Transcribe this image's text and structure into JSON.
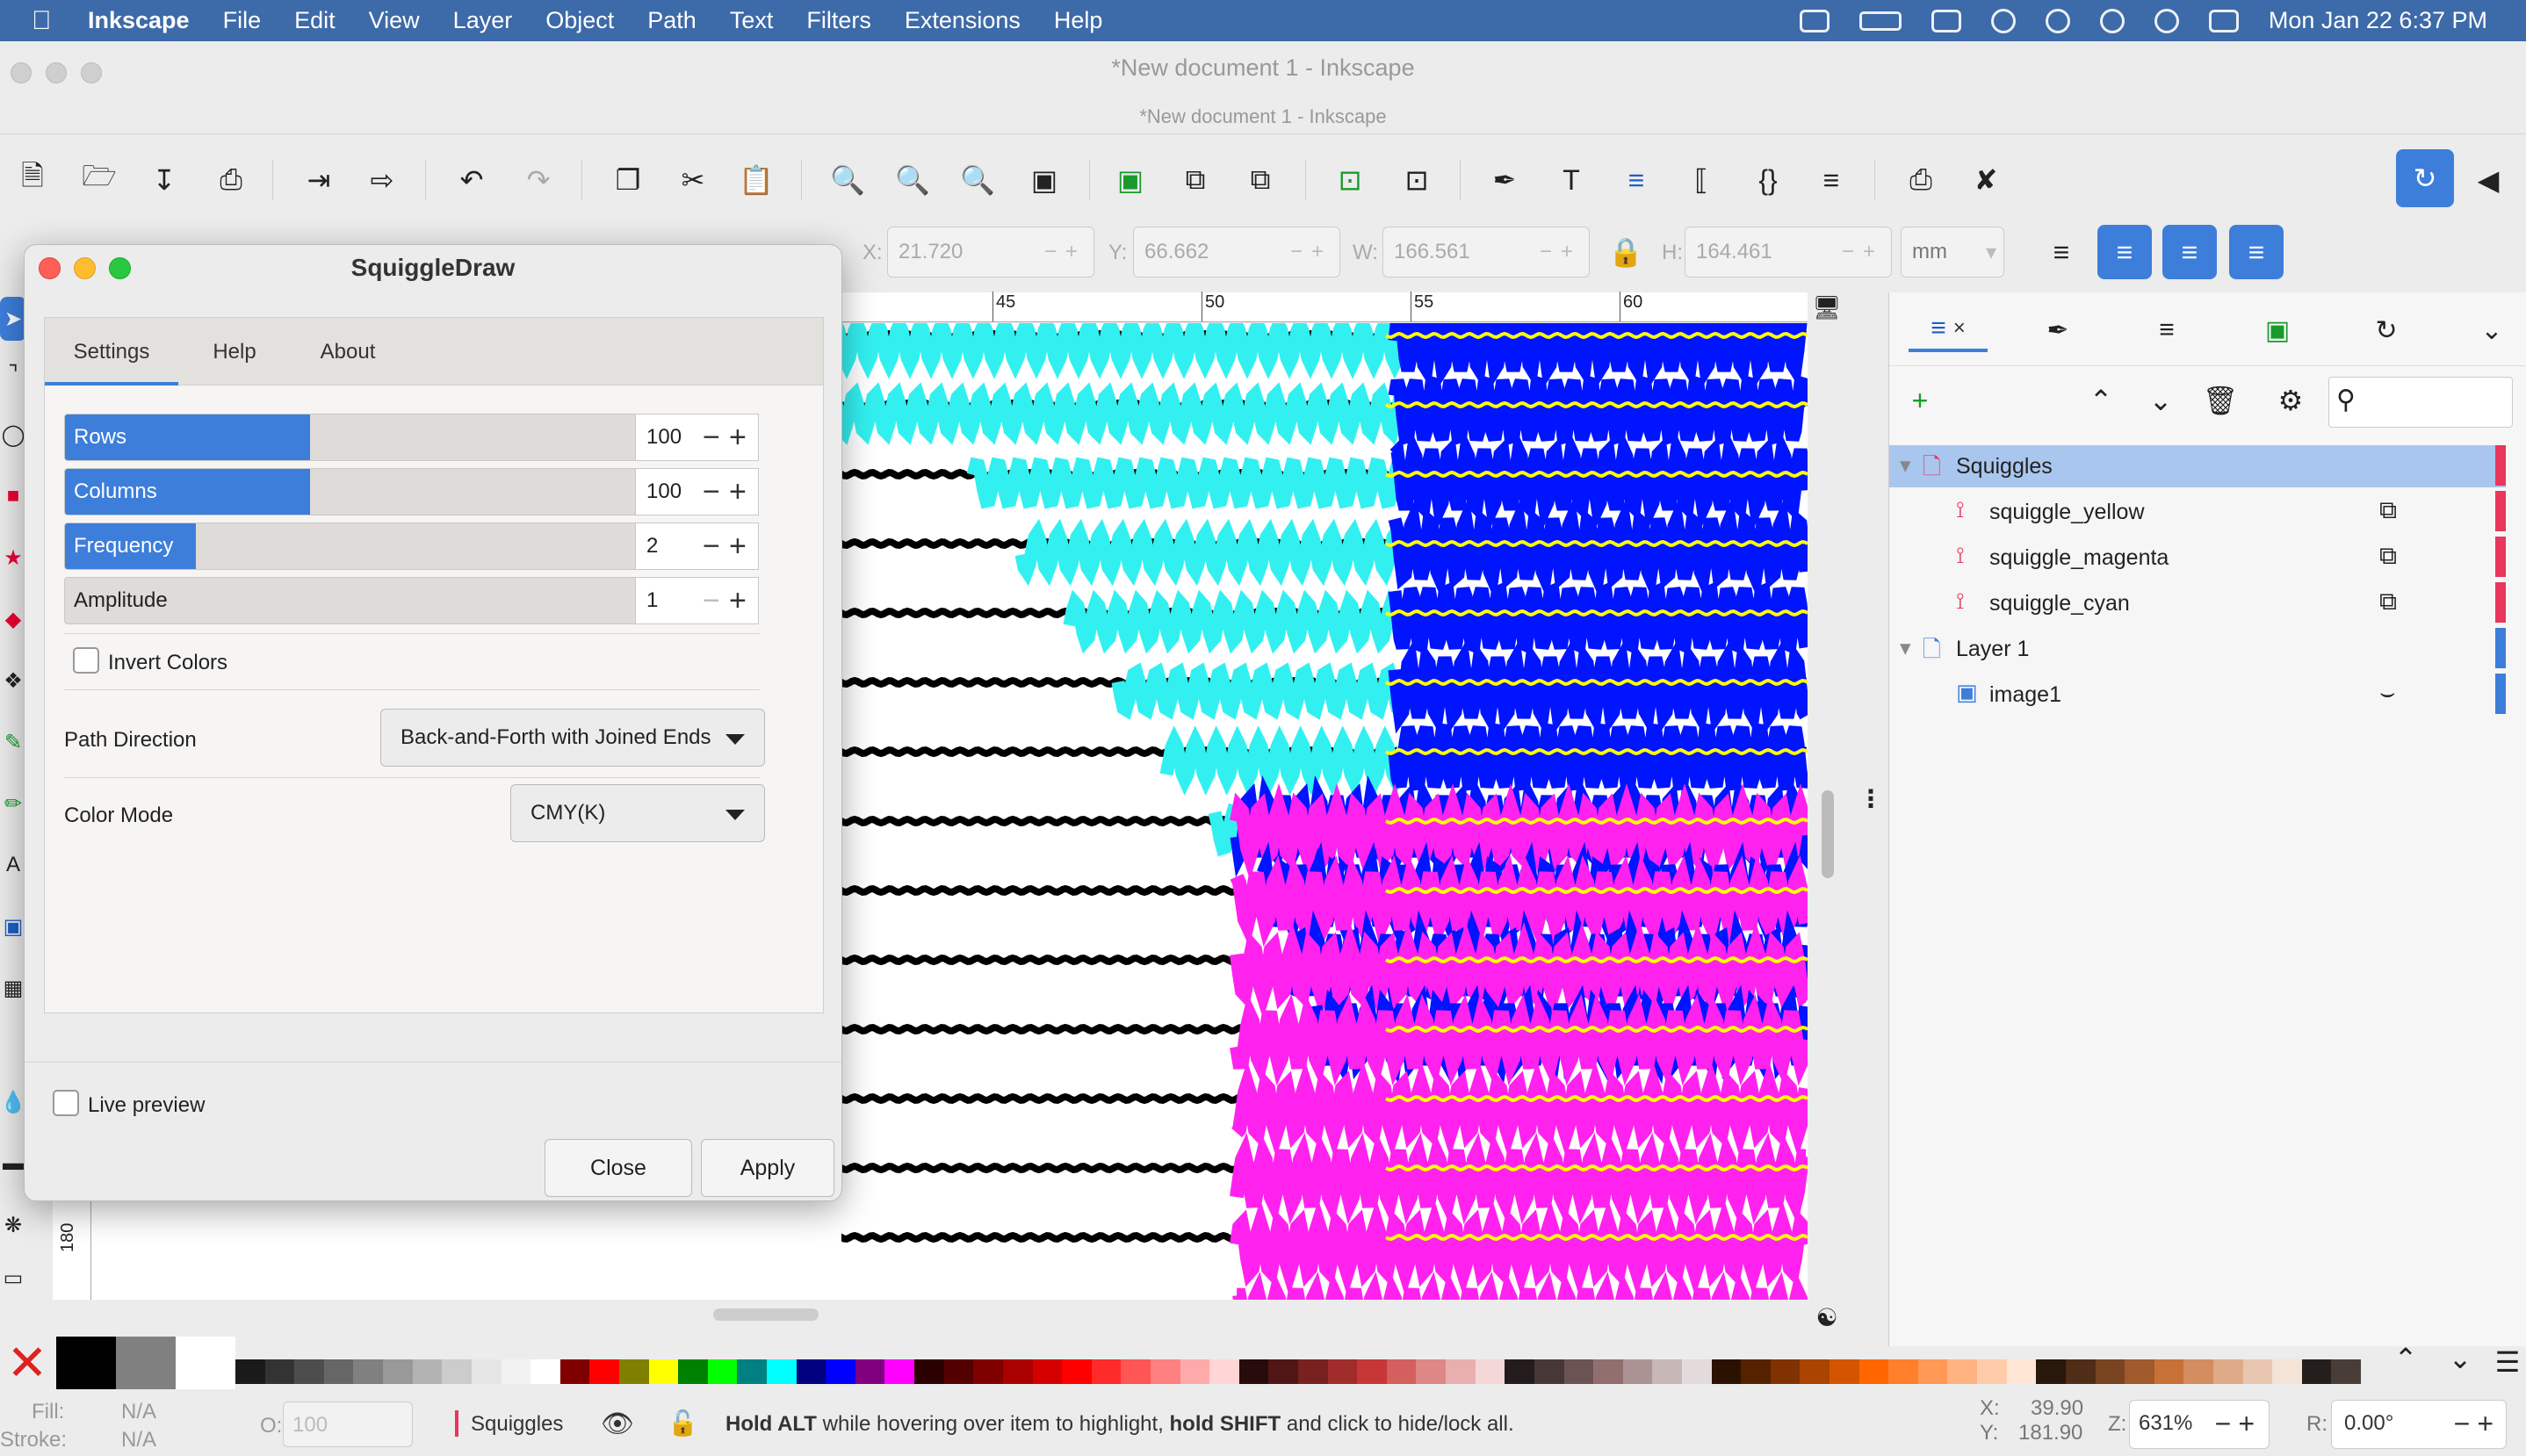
{
  "menubar": {
    "app_name": "Inkscape",
    "items": [
      "File",
      "Edit",
      "View",
      "Layer",
      "Object",
      "Path",
      "Text",
      "Filters",
      "Extensions",
      "Help"
    ],
    "datetime": "Mon Jan 22  6:37 PM"
  },
  "window": {
    "title": "*New document 1 - Inkscape",
    "subtitle": "*New document 1 - Inkscape"
  },
  "controls": {
    "x_label": "X:",
    "x_value": "21.720",
    "y_label": "Y:",
    "y_value": "66.662",
    "w_label": "W:",
    "w_value": "166.561",
    "h_label": "H:",
    "h_value": "164.461",
    "unit": "mm"
  },
  "ruler": {
    "top_ticks": [
      "45",
      "50",
      "55",
      "60"
    ],
    "left_tick": "180"
  },
  "dialog": {
    "title": "SquiggleDraw",
    "tabs": [
      "Settings",
      "Help",
      "About"
    ],
    "rows": {
      "label": "Rows",
      "value": "100",
      "fill": 0.43
    },
    "columns": {
      "label": "Columns",
      "value": "100",
      "fill": 0.43
    },
    "frequency": {
      "label": "Frequency",
      "value": "2",
      "fill": 0.23
    },
    "amplitude": {
      "label": "Amplitude",
      "value": "1",
      "fill": 0.0
    },
    "invert_label": "Invert Colors",
    "path_direction_label": "Path Direction",
    "path_direction_value": "Back-and-Forth with Joined Ends",
    "color_mode_label": "Color Mode",
    "color_mode_value": "CMY(K)",
    "live_preview_label": "Live preview",
    "close_label": "Close",
    "apply_label": "Apply"
  },
  "layers": {
    "items": [
      {
        "name": "Squiggles",
        "level": 0,
        "selected": true,
        "bar": "#e8365d"
      },
      {
        "name": "squiggle_yellow",
        "level": 1,
        "selected": false,
        "bar": "#e8365d"
      },
      {
        "name": "squiggle_magenta",
        "level": 1,
        "selected": false,
        "bar": "#e8365d"
      },
      {
        "name": "squiggle_cyan",
        "level": 1,
        "selected": false,
        "bar": "#e8365d"
      },
      {
        "name": "Layer 1",
        "level": 0,
        "selected": false,
        "bar": "#3d7edb"
      },
      {
        "name": "image1",
        "level": 1,
        "selected": false,
        "bar": "#3d7edb"
      }
    ]
  },
  "statusbar": {
    "fill_label": "Fill:",
    "fill_value": "N/A",
    "stroke_label": "Stroke:",
    "stroke_value": "N/A",
    "opacity_label": "O:",
    "opacity_value": "100",
    "layer_name": "Squiggles",
    "message_1": "Hold ALT",
    "message_2": " while hovering over item to highlight, ",
    "message_3": "hold SHIFT",
    "message_4": " and click to hide/lock all.",
    "cursor_x_label": "X:",
    "cursor_x": "39.90",
    "cursor_y_label": "Y:",
    "cursor_y": "181.90",
    "zoom_label": "Z:",
    "zoom": "631%",
    "rotate_label": "R:",
    "rotate": "0.00°"
  },
  "colors": {
    "menubar": "#3d6aa8",
    "accent": "#3d7edb",
    "cyan": "#33f0f0",
    "blue": "#0014ff",
    "magenta": "#ff22ee",
    "yellow": "#ffff00"
  }
}
